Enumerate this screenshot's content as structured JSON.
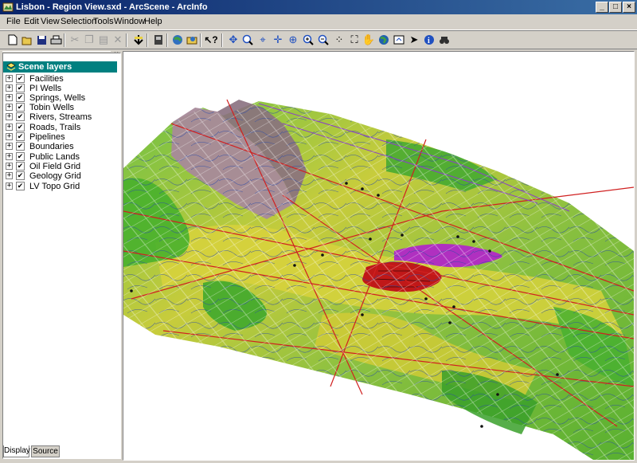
{
  "window": {
    "title": "Lisbon - Region View.sxd - ArcScene - ArcInfo",
    "buttons": [
      "_",
      "□",
      "×"
    ]
  },
  "menu": [
    "File",
    "Edit",
    "View",
    "Selection",
    "Tools",
    "Window",
    "Help"
  ],
  "toolbar": {
    "icons": [
      "new-icon",
      "open-icon",
      "save-icon",
      "print-icon",
      "cut-icon",
      "copy-icon",
      "paste-icon",
      "delete-icon",
      "add-data-icon",
      "animation-icon",
      "scene-properties-icon",
      "arccatalog-icon",
      "whats-this-icon",
      "navigate-icon",
      "zoom-in-out-icon",
      "center-on-target-icon",
      "zoom-to-target-icon",
      "set-observer-icon",
      "zoom-in-icon",
      "zoom-out-icon",
      "full-extent-icon",
      "fixed-extent-icon",
      "pan-icon",
      "globe-icon",
      "identify-layer-icon",
      "select-elements-icon",
      "info-icon",
      "find-icon"
    ]
  },
  "toc": {
    "header": "Scene layers",
    "layers": [
      {
        "label": "Facilities",
        "checked": true
      },
      {
        "label": "PI Wells",
        "checked": true
      },
      {
        "label": "Springs, Wells",
        "checked": true
      },
      {
        "label": "Tobin Wells",
        "checked": true
      },
      {
        "label": "Rivers, Streams",
        "checked": true
      },
      {
        "label": "Roads, Trails",
        "checked": true
      },
      {
        "label": "Pipelines",
        "checked": true
      },
      {
        "label": "Boundaries",
        "checked": true
      },
      {
        "label": "Public Lands",
        "checked": true
      },
      {
        "label": "Oil Field Grid",
        "checked": true
      },
      {
        "label": "Geology Grid",
        "checked": true
      },
      {
        "label": "LV Topo Grid",
        "checked": true
      }
    ],
    "tabs": [
      "Display",
      "Source"
    ],
    "active_tab": "Display",
    "close": "×"
  },
  "colors": {
    "title_bar": "#0a246a",
    "toc_header": "#008080",
    "terrain_green": "#5fbf3a",
    "terrain_yellow": "#d6d23a",
    "terrain_magenta": "#b030c0",
    "terrain_red": "#c01818",
    "terrain_mountain": "#a88a9a",
    "roads": "#d02020",
    "streams": "#3050b0"
  }
}
